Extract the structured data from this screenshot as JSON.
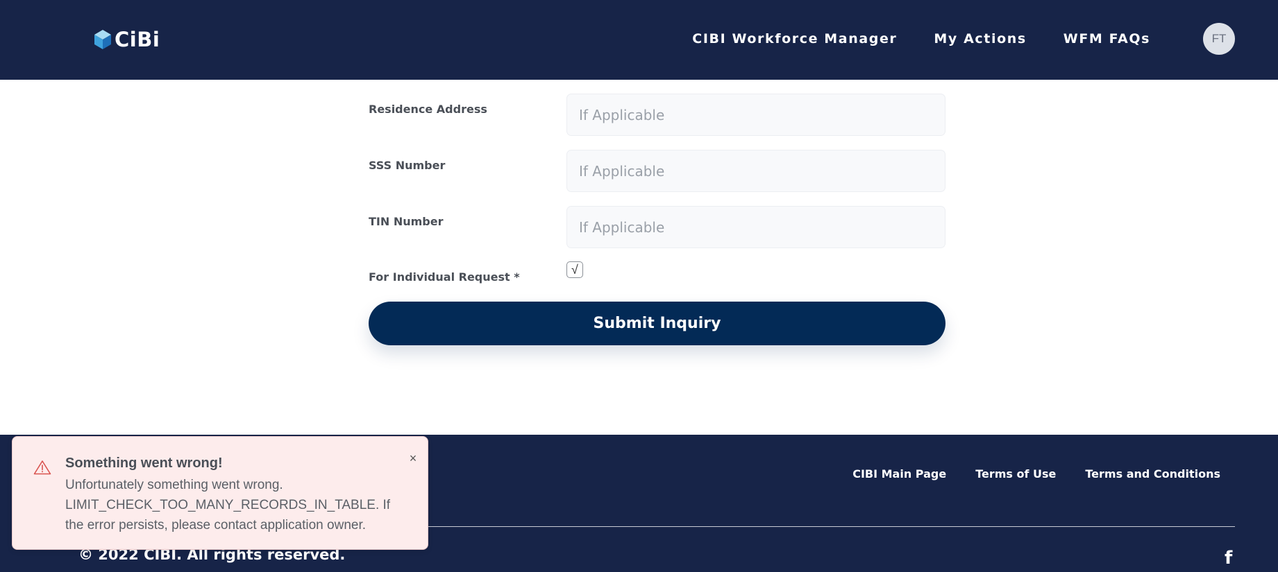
{
  "header": {
    "logo_text": "CiBi",
    "nav": [
      {
        "label": "CIBI Workforce Manager"
      },
      {
        "label": "My Actions"
      },
      {
        "label": "WFM FAQs"
      }
    ],
    "avatar_initials": "FT"
  },
  "form": {
    "fields": [
      {
        "label": "Residence Address",
        "placeholder": "If Applicable",
        "value": ""
      },
      {
        "label": "SSS Number",
        "placeholder": "If Applicable",
        "value": ""
      },
      {
        "label": "TIN Number",
        "placeholder": "If Applicable",
        "value": ""
      }
    ],
    "individual_request": {
      "label": "For Individual Request *",
      "checked": true,
      "check_glyph": "√"
    },
    "submit_label": "Submit Inquiry"
  },
  "footer": {
    "links": [
      {
        "label": "CIBI Main Page"
      },
      {
        "label": "Terms of Use"
      },
      {
        "label": "Terms and Conditions"
      }
    ],
    "copyright": "© 2022 CIBI. All rights reserved.",
    "social_icon_glyph": "f"
  },
  "toast": {
    "title": "Something went wrong!",
    "message": "Unfortunately something went wrong. LIMIT_CHECK_TOO_MANY_RECORDS_IN_TABLE. If the error persists, please contact application owner.",
    "close_glyph": "×"
  },
  "colors": {
    "header_bg": "#172448",
    "button_bg": "#032a56",
    "toast_bg": "#fdecec",
    "toast_icon": "#d9534f"
  },
  "icons": [
    "cibi-logo-icon",
    "warning-icon",
    "close-icon",
    "facebook-icon",
    "check-icon"
  ]
}
